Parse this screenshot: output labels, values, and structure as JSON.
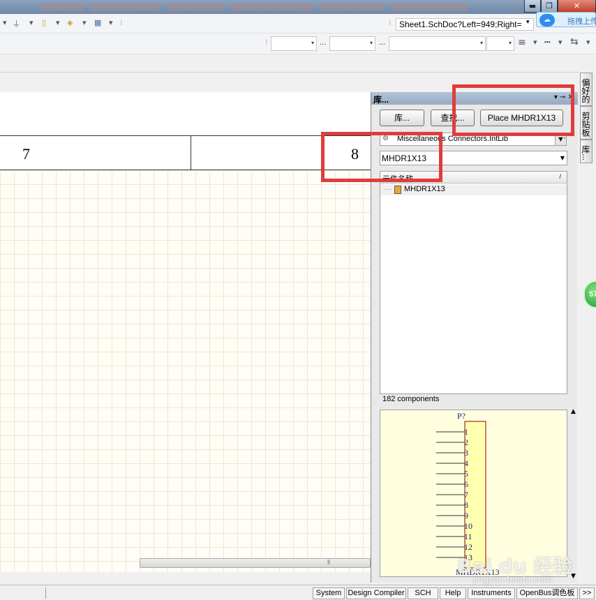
{
  "window": {
    "minimize": "▬",
    "maximize": "❐",
    "close": "✕",
    "baidu_upload": "拖拽上传"
  },
  "toolbar": {
    "document_path": "Sheet1.SchDoc?Left=949;Right=",
    "more": "..."
  },
  "sheet": {
    "zones": [
      "7",
      "8"
    ]
  },
  "library_panel": {
    "title": "库...",
    "buttons": {
      "libraries": "库...",
      "search": "查找...",
      "place": "Place MHDR1X13"
    },
    "library_selected": "Miscellaneous Connectors.IntLib",
    "filter_value": "MHDR1X13",
    "list_header": "元件名称",
    "sort_indicator": "/",
    "components": [
      "MHDR1X13"
    ],
    "component_count": "182 components"
  },
  "preview": {
    "designator": "P?",
    "pins": [
      "1",
      "2",
      "3",
      "4",
      "5",
      "6",
      "7",
      "8",
      "9",
      "10",
      "11",
      "12",
      "13"
    ],
    "comment": "MHDR1X13"
  },
  "dock_tabs": [
    "偏好的",
    "剪贴板",
    "库..."
  ],
  "green_badge": "57",
  "status_bar": {
    "tabs": [
      "System",
      "Design Compiler",
      "SCH",
      "Help",
      "Instruments",
      "OpenBus调色板"
    ],
    "overflow": ">>"
  },
  "watermark": {
    "logo": "Bai  du 经验",
    "url": "jingyan.baidu.com"
  },
  "colors": {
    "annotation_red": "#e03c3c",
    "sheet_bg": "#fffdf5",
    "preview_bg": "#ffffe0",
    "pin_text_blue": "#1a1a8c"
  }
}
